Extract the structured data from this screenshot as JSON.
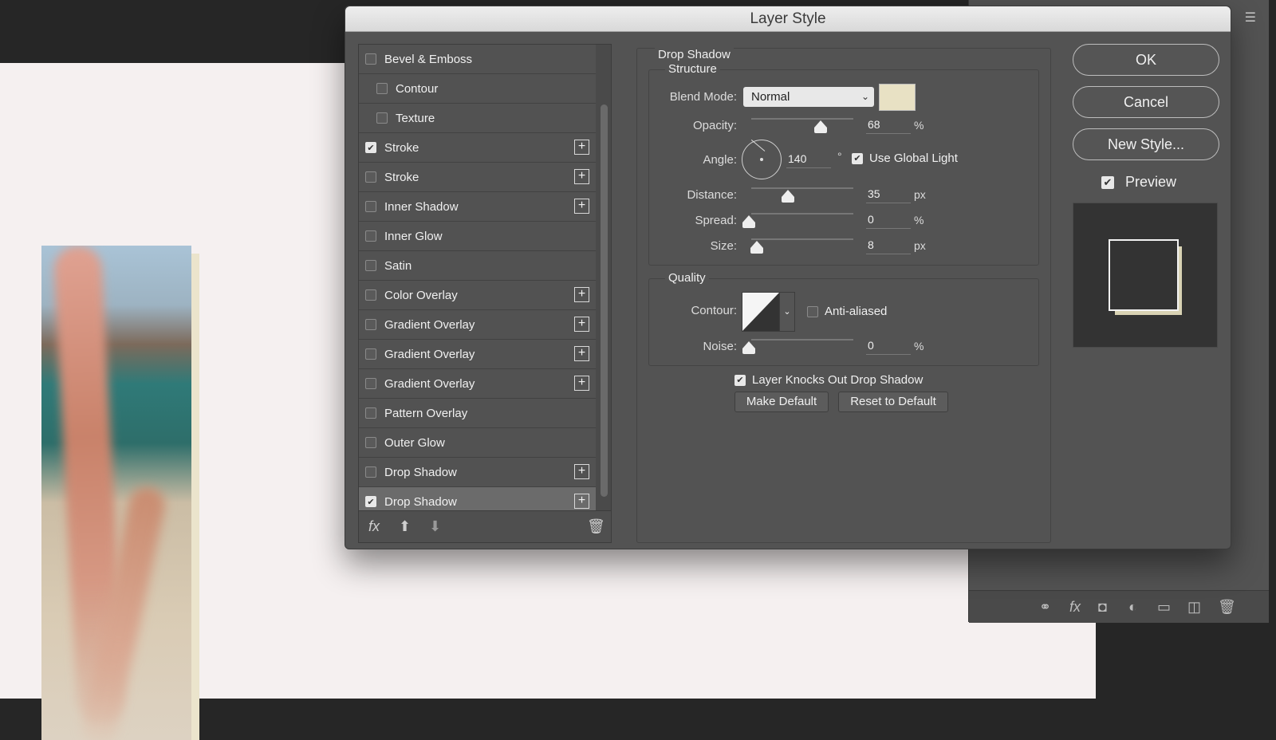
{
  "dialog": {
    "title": "Layer Style"
  },
  "style_list": {
    "items": [
      {
        "label": "Bevel & Emboss",
        "checked": false,
        "sub": false,
        "plus": false
      },
      {
        "label": "Contour",
        "checked": false,
        "sub": true,
        "plus": false
      },
      {
        "label": "Texture",
        "checked": false,
        "sub": true,
        "plus": false
      },
      {
        "label": "Stroke",
        "checked": true,
        "sub": false,
        "plus": true
      },
      {
        "label": "Stroke",
        "checked": false,
        "sub": false,
        "plus": true
      },
      {
        "label": "Inner Shadow",
        "checked": false,
        "sub": false,
        "plus": true
      },
      {
        "label": "Inner Glow",
        "checked": false,
        "sub": false,
        "plus": false
      },
      {
        "label": "Satin",
        "checked": false,
        "sub": false,
        "plus": false
      },
      {
        "label": "Color Overlay",
        "checked": false,
        "sub": false,
        "plus": true
      },
      {
        "label": "Gradient Overlay",
        "checked": false,
        "sub": false,
        "plus": true
      },
      {
        "label": "Gradient Overlay",
        "checked": false,
        "sub": false,
        "plus": true
      },
      {
        "label": "Gradient Overlay",
        "checked": false,
        "sub": false,
        "plus": true
      },
      {
        "label": "Pattern Overlay",
        "checked": false,
        "sub": false,
        "plus": false
      },
      {
        "label": "Outer Glow",
        "checked": false,
        "sub": false,
        "plus": false
      },
      {
        "label": "Drop Shadow",
        "checked": false,
        "sub": false,
        "plus": true
      },
      {
        "label": "Drop Shadow",
        "checked": true,
        "sub": false,
        "plus": true,
        "selected": true
      }
    ],
    "footer": {
      "fx": "fx",
      "icons": [
        "fx-icon",
        "move-up-icon",
        "move-down-icon",
        "trash-icon"
      ]
    }
  },
  "drop_shadow": {
    "title": "Drop Shadow",
    "structure_label": "Structure",
    "blend_mode_label": "Blend Mode:",
    "blend_mode_value": "Normal",
    "shadow_color": "#e8e1c4",
    "opacity_label": "Opacity:",
    "opacity_value": "68",
    "opacity_unit": "%",
    "angle_label": "Angle:",
    "angle_value": "140",
    "angle_unit": "°",
    "use_global_light_label": "Use Global Light",
    "use_global_light": true,
    "distance_label": "Distance:",
    "distance_value": "35",
    "distance_unit": "px",
    "spread_label": "Spread:",
    "spread_value": "0",
    "spread_unit": "%",
    "size_label": "Size:",
    "size_value": "8",
    "size_unit": "px",
    "quality_label": "Quality",
    "contour_label": "Contour:",
    "anti_aliased_label": "Anti-aliased",
    "anti_aliased": false,
    "noise_label": "Noise:",
    "noise_value": "0",
    "noise_unit": "%",
    "knockout_label": "Layer Knocks Out Drop Shadow",
    "knockout": true,
    "make_default_label": "Make Default",
    "reset_default_label": "Reset to Default"
  },
  "actions": {
    "ok_label": "OK",
    "cancel_label": "Cancel",
    "new_style_label": "New Style...",
    "preview_label": "Preview",
    "preview_checked": true
  },
  "background_panel": {
    "footer_icons": [
      "link-icon",
      "fx-icon",
      "mask-icon",
      "adjustment-icon",
      "folder-icon",
      "new-layer-icon",
      "trash-icon"
    ]
  }
}
